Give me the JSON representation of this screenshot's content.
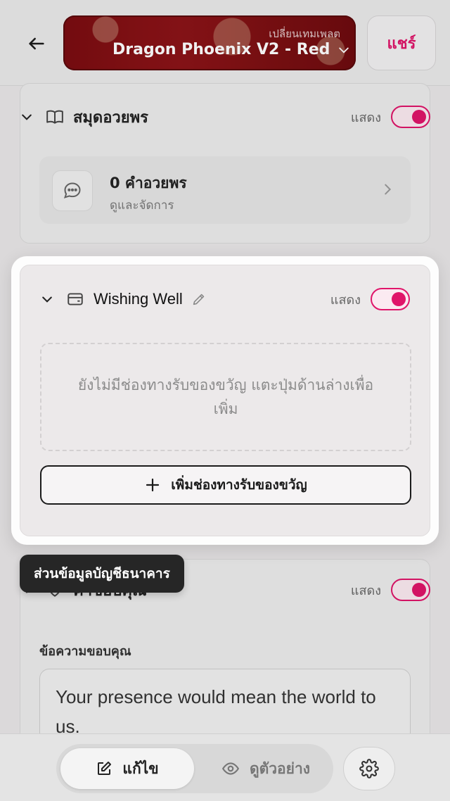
{
  "header": {
    "template_hint": "เปลี่ยนเทมเพลต",
    "template_name": "Dragon Phoenix V2 - Red",
    "share_label": "แชร์"
  },
  "blessing_book": {
    "title": "สมุดอวยพร",
    "show_label": "แสดง",
    "toggle_on": true,
    "count_label": "0 คำอวยพร",
    "manage_label": "ดูและจัดการ"
  },
  "wishing_well": {
    "title": "Wishing Well",
    "show_label": "แสดง",
    "toggle_on": true,
    "empty_message": "ยังไม่มีช่องทางรับของขวัญ แตะปุ่มด้านล่างเพื่อเพิ่ม",
    "add_button_label": "เพิ่มช่องทางรับของขวัญ"
  },
  "tooltip": {
    "text": "ส่วนข้อมูลบัญชีธนาคาร"
  },
  "thank_you": {
    "title": "คำขอบคุณ",
    "show_label": "แสดง",
    "toggle_on": true,
    "field_label": "ข้อความขอบคุณ",
    "message": "Your presence would mean the world to us."
  },
  "bottom_bar": {
    "edit_label": "แก้ไข",
    "preview_label": "ดูตัวอย่าง"
  },
  "colors": {
    "accent": "#e0156a",
    "template_bg": "#7b0c11",
    "tooltip_bg": "#262626"
  }
}
